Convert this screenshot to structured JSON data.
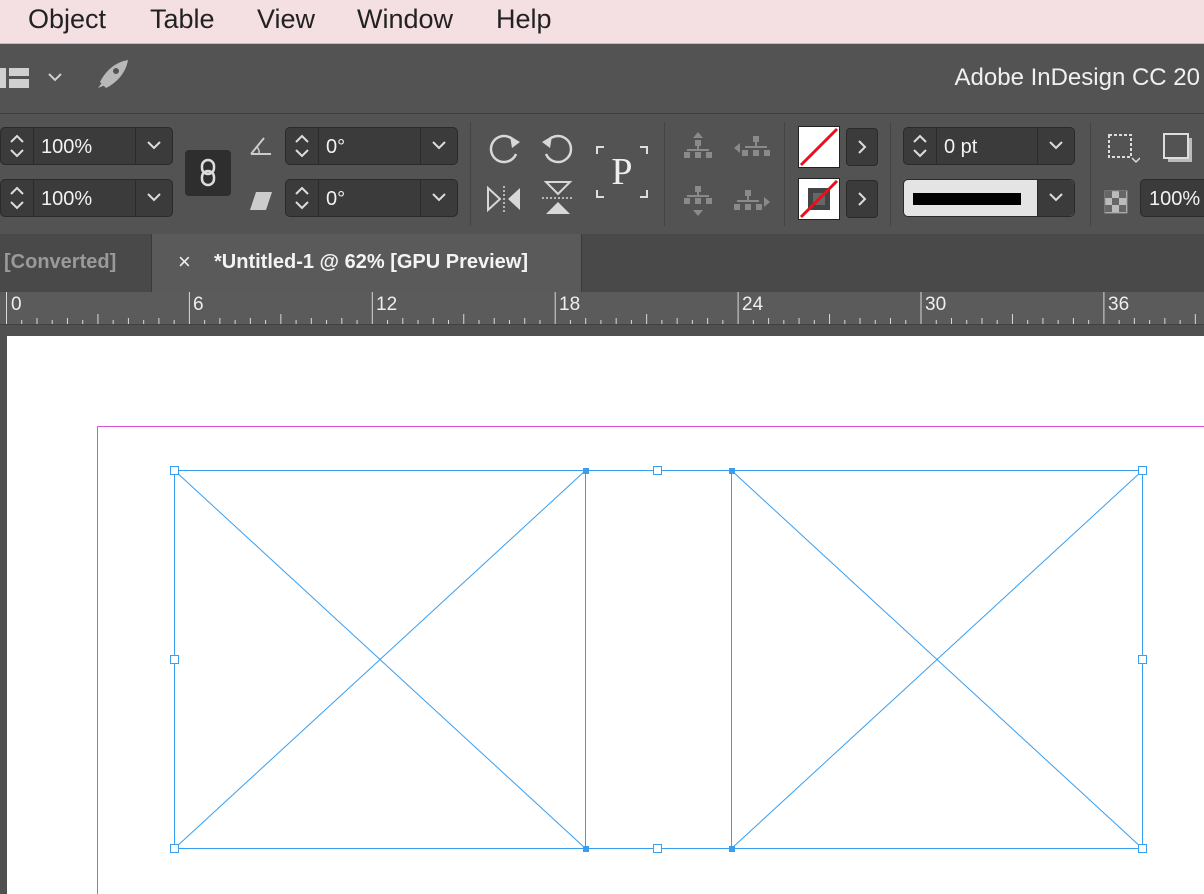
{
  "menu": {
    "items": [
      "Object",
      "Table",
      "View",
      "Window",
      "Help"
    ]
  },
  "app": {
    "title": "Adobe InDesign CC 20"
  },
  "control": {
    "scale_x": "100%",
    "scale_y": "100%",
    "rotation": "0°",
    "shear": "0°",
    "stroke_weight": "0 pt",
    "opacity": "100%"
  },
  "tabs": {
    "items": [
      {
        "label": "[Converted]",
        "active": false
      },
      {
        "label": "*Untitled-1 @ 62% [GPU Preview]",
        "active": true,
        "close": "×"
      }
    ]
  },
  "ruler": {
    "labels": [
      "0",
      "6",
      "12",
      "18",
      "24",
      "30",
      "36"
    ]
  },
  "colors": {
    "menu_bg": "#f4dfe2",
    "ui_bg": "#535353",
    "selection": "#3a9ef0",
    "margin": "#d94fd5",
    "none_slash": "#e8101a"
  },
  "icons": {
    "workspace": "layout-grid-icon",
    "publish": "rocket-icon",
    "constrain": "chain-link-icon",
    "rotate_angle": "angle-icon",
    "shear_angle": "shear-icon",
    "rotate_cw": "rotate-clockwise-icon",
    "rotate_ccw": "rotate-counterclockwise-icon",
    "flip_h": "flip-horizontal-icon",
    "flip_v": "flip-vertical-icon",
    "text_frame": "text-frame-icon"
  }
}
